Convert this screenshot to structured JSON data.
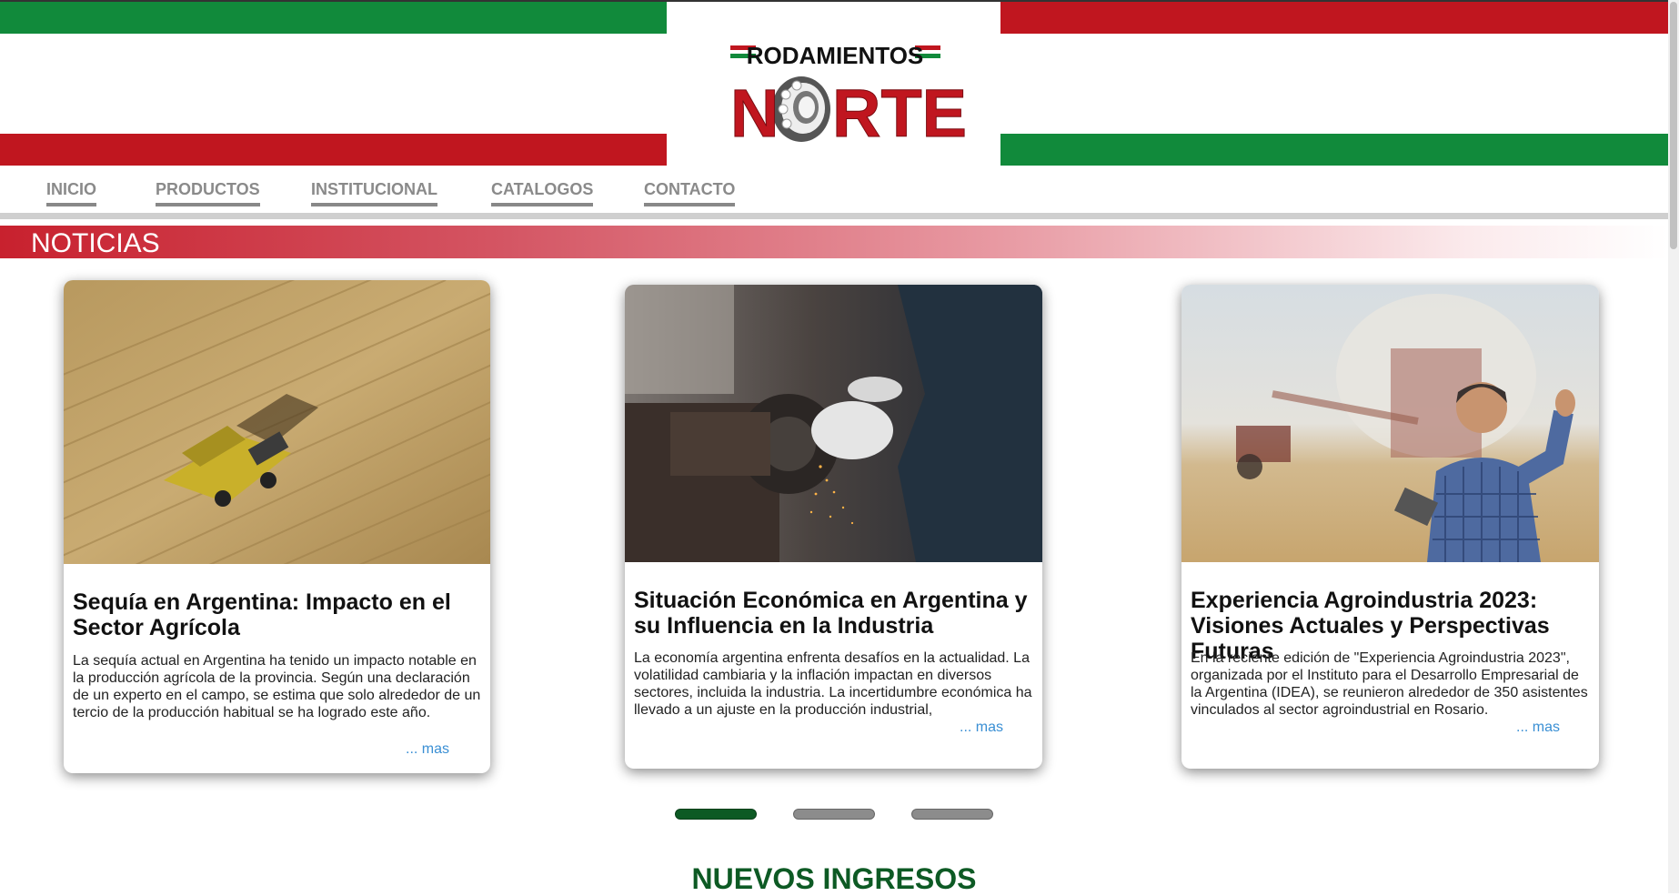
{
  "header": {
    "logo_text_top": "RODAMIENTOS",
    "logo_text_main": "NORTE",
    "colors": {
      "green": "#118a3b",
      "red": "#c0161f"
    }
  },
  "nav": {
    "items": [
      {
        "label": "INICIO"
      },
      {
        "label": "PRODUCTOS"
      },
      {
        "label": "INSTITUCIONAL"
      },
      {
        "label": "CATALOGOS"
      },
      {
        "label": "CONTACTO"
      }
    ]
  },
  "news": {
    "section_title": "NOTICIAS",
    "cards": [
      {
        "image": "combine-harvester-aerial",
        "title": "Sequía en Argentina: Impacto en el Sector Agrícola",
        "text": "La sequía actual en Argentina ha tenido un impacto notable en la producción agrícola de la provincia. Según una declaración de un experto en el campo, se estima que solo alrededor de un tercio de la producción habitual se ha logrado este año.",
        "more": "... mas"
      },
      {
        "image": "grinder-worker-sparks",
        "title": "Situación Económica en Argentina y su Influencia en la Industria",
        "text": "La economía argentina enfrenta desafíos en la actualidad. La volatilidad cambiaria y la inflación impactan en diversos sectores, incluida la industria. La incertidumbre económica ha llevado a un ajuste en la producción industrial,",
        "more": "... mas"
      },
      {
        "image": "farmer-thumbs-up",
        "title": "Experiencia Agroindustria 2023: Visiones Actuales y Perspectivas Futuras",
        "text": "En la reciente edición de \"Experiencia Agroindustria 2023\", organizada por el Instituto para el Desarrollo Empresarial de la Argentina (IDEA), se reunieron alrededor de 350 asistentes vinculados al sector agroindustrial en Rosario.",
        "more": "... mas"
      }
    ],
    "carousel": {
      "pages": 3,
      "active": 1
    }
  },
  "new_arrivals": {
    "title": "NUEVOS INGRESOS"
  }
}
